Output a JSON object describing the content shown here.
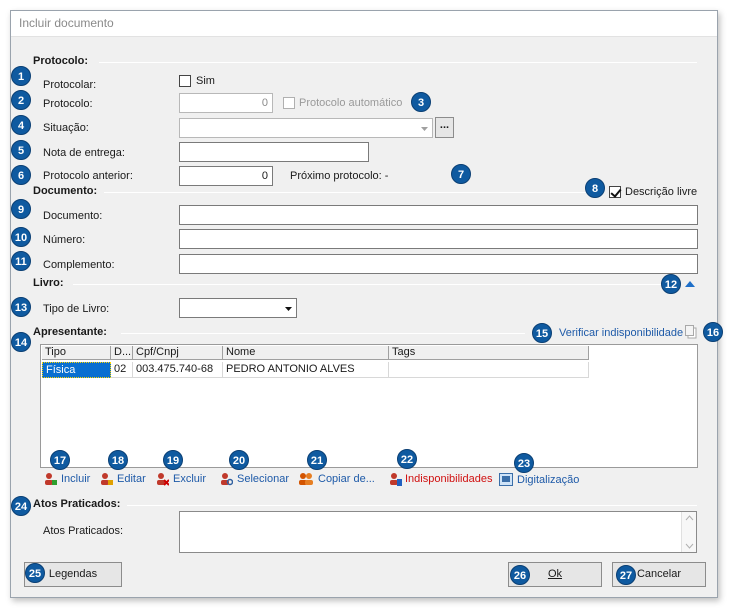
{
  "window": {
    "title": "Incluir documento"
  },
  "protocolo": {
    "section_title": "Protocolo:",
    "protocolar_label": "Protocolar:",
    "sim_label": "Sim",
    "protocolo_label": "Protocolo:",
    "protocolo_value": "0",
    "protocolo_automatico_label": "Protocolo automático",
    "situacao_label": "Situação:",
    "situacao_value": "",
    "ellipsis_label": "...",
    "nota_label": "Nota de entrega:",
    "nota_value": "",
    "anterior_label": "Protocolo anterior:",
    "anterior_value": "0",
    "proximo_label": "Próximo protocolo: -"
  },
  "documento": {
    "section_title": "Documento:",
    "descricao_livre_label": "Descrição livre",
    "documento_label": "Documento:",
    "numero_label": "Número:",
    "complemento_label": "Complemento:"
  },
  "livro": {
    "section_title": "Livro:",
    "tipo_label": "Tipo de Livro:",
    "tipo_value": ""
  },
  "apresentante": {
    "section_title": "Apresentante:",
    "verificar_label": "Verificar indisponibilidade",
    "columns": [
      "Tipo",
      "D...",
      "Cpf/Cnpj",
      "Nome",
      "Tags"
    ],
    "rows": [
      {
        "tipo": "Física",
        "d": "02",
        "cpf": "003.475.740-68",
        "nome": "PEDRO ANTONIO ALVES",
        "tags": ""
      }
    ],
    "actions": {
      "incluir": "Incluir",
      "editar": "Editar",
      "excluir": "Excluir",
      "selecionar": "Selecionar",
      "copiar": "Copiar de...",
      "indisponibilidades": "Indisponibilidades",
      "digitalizacao": "Digitalização"
    }
  },
  "atos": {
    "section_title": "Atos Praticados:",
    "label": "Atos Praticados:",
    "value": ""
  },
  "footer": {
    "legendas": "Legendas",
    "ok": "Ok",
    "cancelar": "Cancelar"
  },
  "badges": [
    "1",
    "2",
    "3",
    "4",
    "5",
    "6",
    "7",
    "8",
    "9",
    "10",
    "11",
    "12",
    "13",
    "14",
    "15",
    "16",
    "17",
    "18",
    "19",
    "20",
    "21",
    "22",
    "23",
    "24",
    "25",
    "26",
    "27"
  ],
  "colors": {
    "badge": "#0f5aa0",
    "link": "#1e5aa8",
    "warning_link": "#d01010",
    "selection": "#0a6fd0"
  }
}
